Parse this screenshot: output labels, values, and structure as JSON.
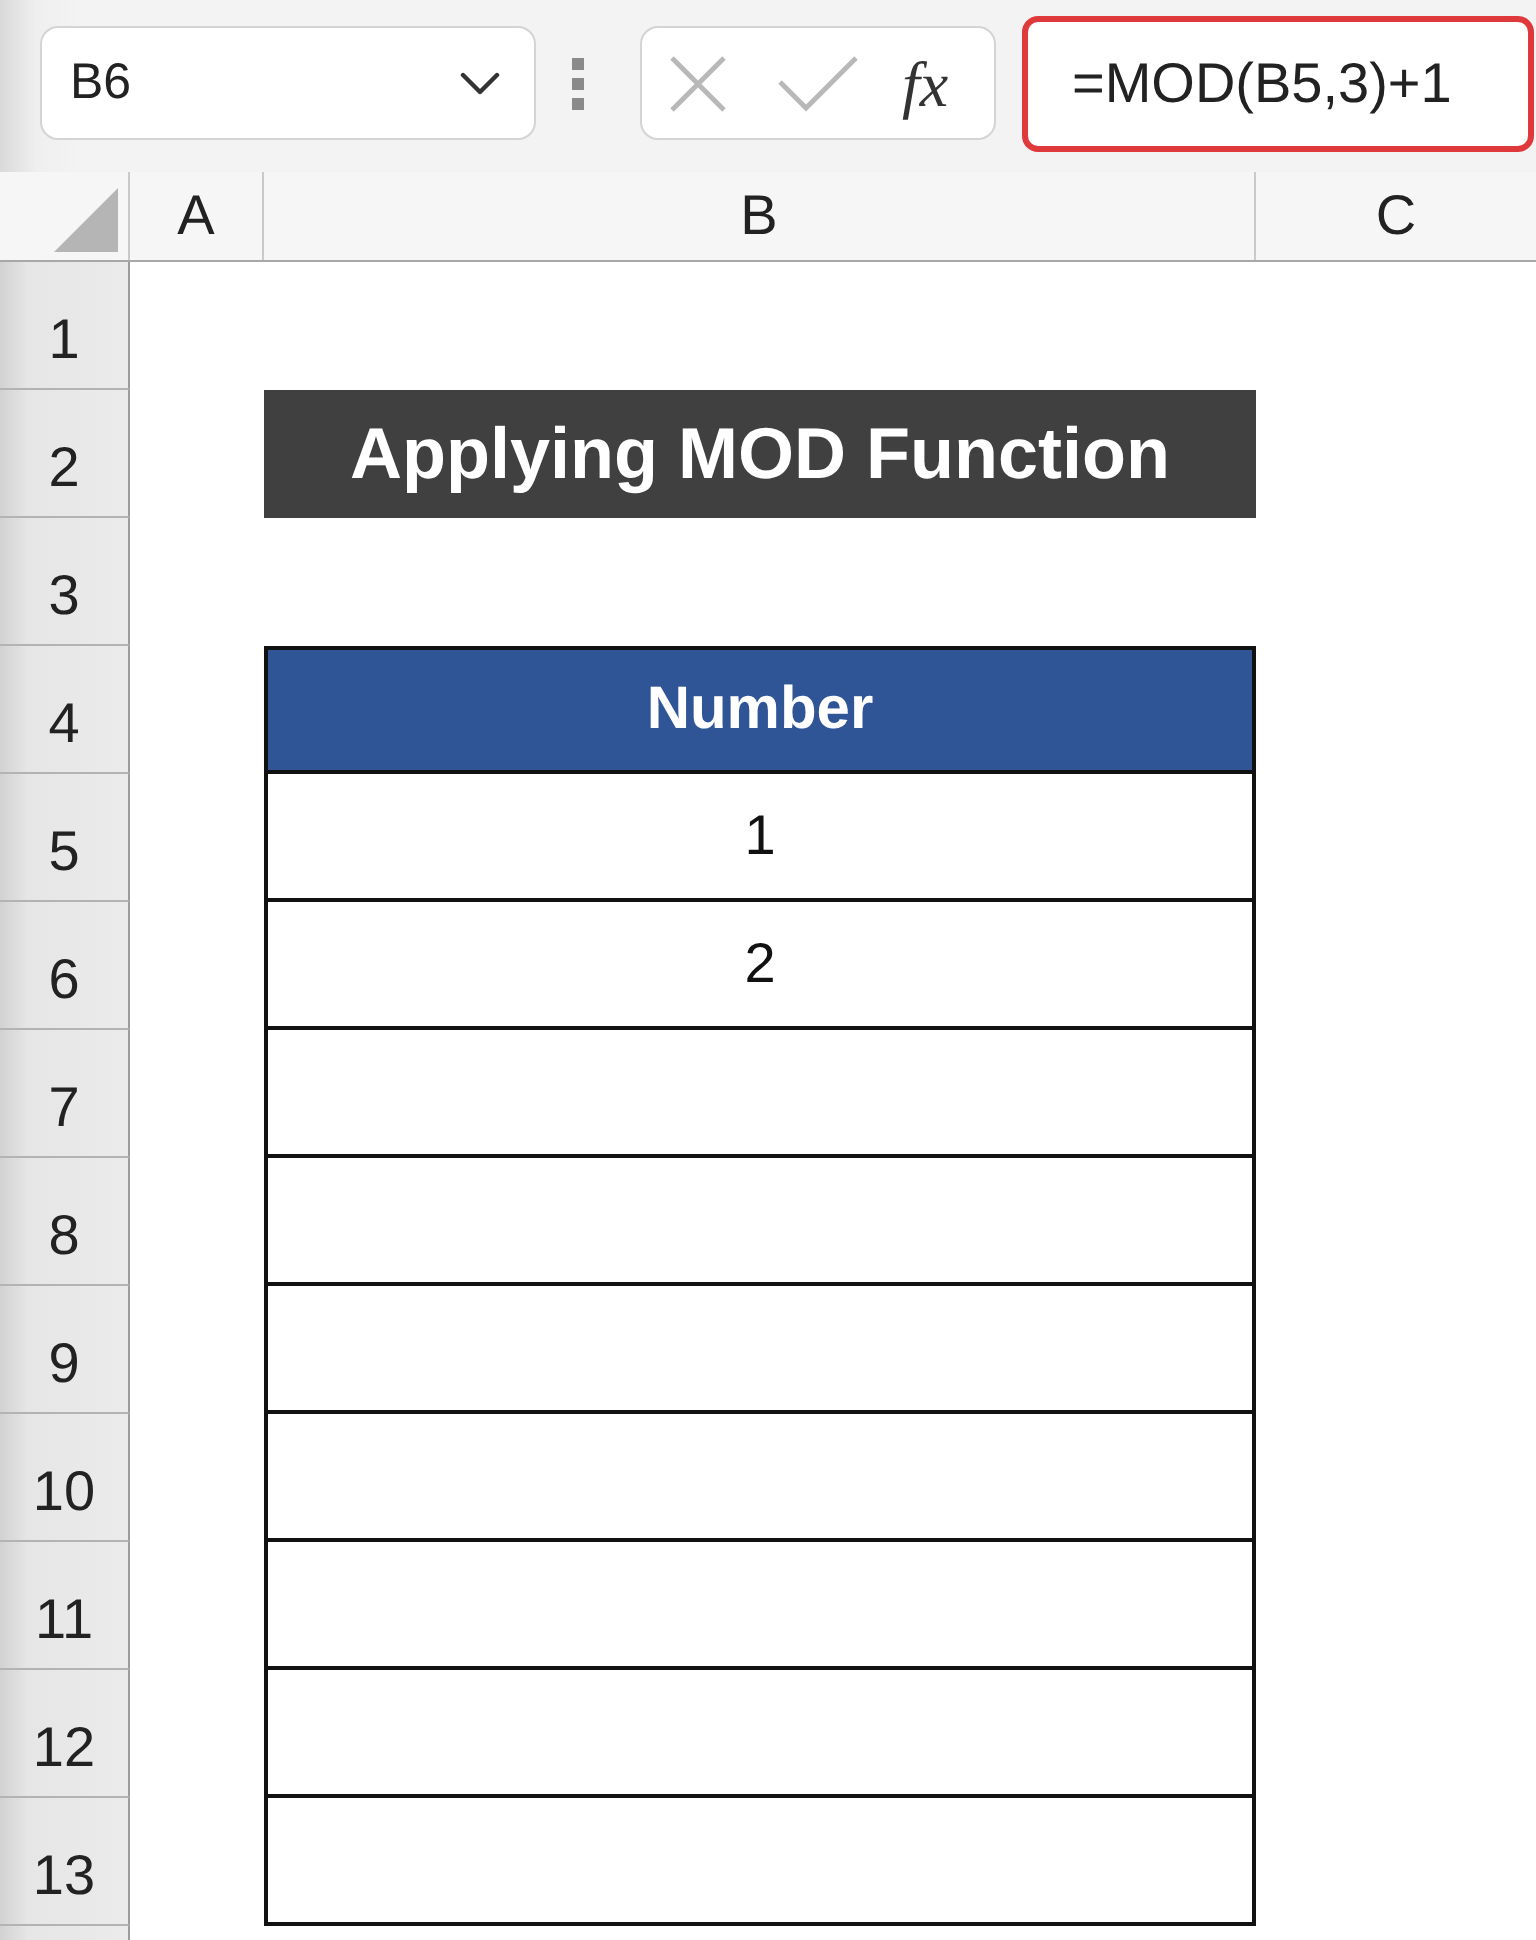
{
  "formula_bar": {
    "name_box": "B6",
    "insert_function": "fx",
    "formula": "=MOD(B5,3)+1",
    "highlighted": true
  },
  "columns": [
    "A",
    "B",
    "C"
  ],
  "rows": [
    {
      "number": "1",
      "kind": "blank"
    },
    {
      "number": "2",
      "kind": "title",
      "text": "Applying MOD Function"
    },
    {
      "number": "3",
      "kind": "blank"
    },
    {
      "number": "4",
      "kind": "header",
      "text": "Number"
    },
    {
      "number": "5",
      "kind": "cell",
      "text": "1"
    },
    {
      "number": "6",
      "kind": "cell",
      "text": "2"
    },
    {
      "number": "7",
      "kind": "cell"
    },
    {
      "number": "8",
      "kind": "cell"
    },
    {
      "number": "9",
      "kind": "cell"
    },
    {
      "number": "10",
      "kind": "cell"
    },
    {
      "number": "11",
      "kind": "cell"
    },
    {
      "number": "12",
      "kind": "cell"
    },
    {
      "number": "13",
      "kind": "cell"
    }
  ]
}
